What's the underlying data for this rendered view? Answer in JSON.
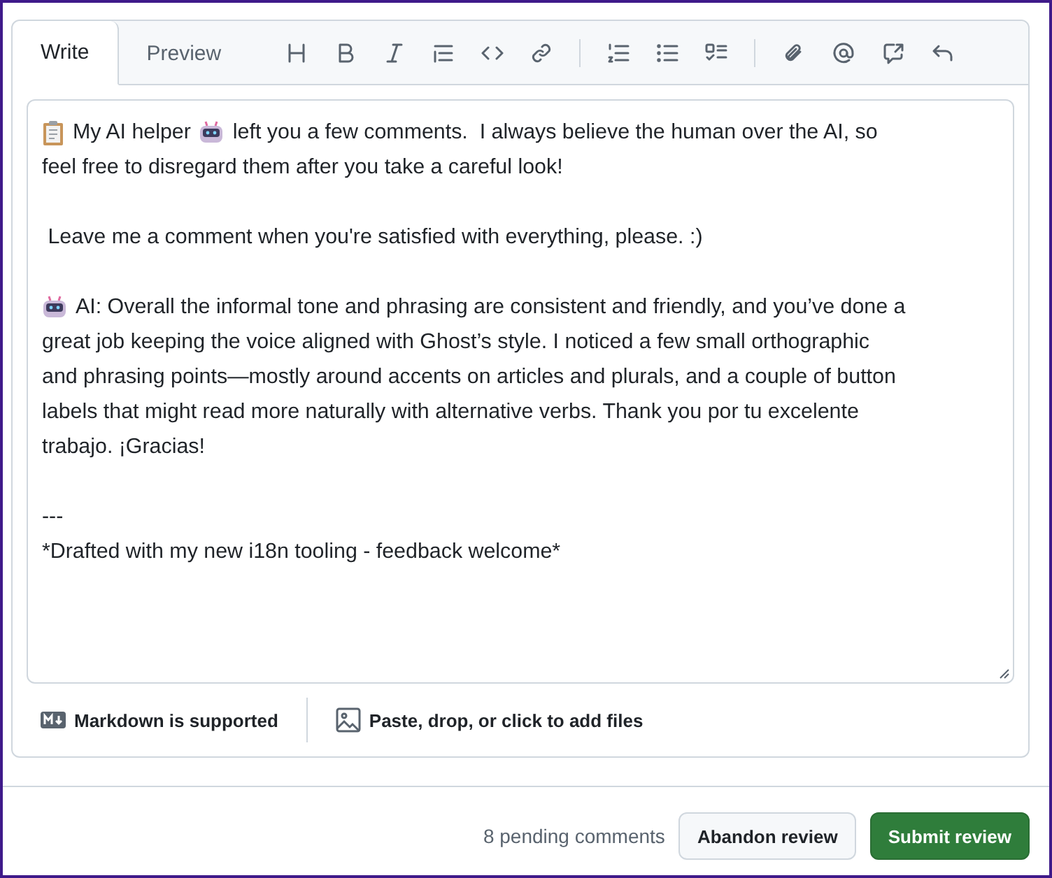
{
  "tabs": [
    {
      "label": "Write",
      "selected": true
    },
    {
      "label": "Preview",
      "selected": false
    }
  ],
  "comment": {
    "paragraphs": [
      {
        "lines": [
          [
            {
              "kind": "clipboard"
            },
            {
              "kind": "text",
              "text": "My AI helper"
            },
            {
              "kind": "robot"
            },
            {
              "kind": "text",
              "text": "left you a few comments.  I always believe the human over the AI, so"
            }
          ],
          [
            {
              "kind": "text",
              "text": "feel free to disregard them after you take a careful look!"
            }
          ]
        ]
      },
      {
        "lines": [
          [
            {
              "kind": "text",
              "text": " Leave me a comment when you're satisfied with everything, please. :)"
            }
          ]
        ]
      },
      {
        "lines": [
          [
            {
              "kind": "robot"
            },
            {
              "kind": "text",
              "text": "AI: Overall the informal tone and phrasing are consistent and friendly, and you’ve done a"
            }
          ],
          [
            {
              "kind": "text",
              "text": "great job keeping the voice aligned with Ghost’s style. I noticed a few small orthographic"
            }
          ],
          [
            {
              "kind": "text",
              "text": "and phrasing points—mostly around accents on articles and plurals, and a couple of button"
            }
          ],
          [
            {
              "kind": "text",
              "text": "labels that might read more naturally with alternative verbs. Thank you por tu excelente"
            }
          ],
          [
            {
              "kind": "text",
              "text": "trabajo. ¡Gracias!"
            }
          ]
        ]
      },
      {
        "lines": [
          [
            {
              "kind": "text",
              "text": "---"
            }
          ],
          [
            {
              "kind": "text",
              "text": "*Drafted with my new i18n tooling - feedback welcome*"
            }
          ]
        ]
      }
    ]
  },
  "markdown_note": "Markdown is supported",
  "attach_hint": "Paste, drop, or click to add files",
  "pending": "8 pending comments",
  "buttons": [
    {
      "label": "Abandon review",
      "kind": "secondary"
    },
    {
      "label": "Submit review",
      "kind": "primary"
    }
  ]
}
